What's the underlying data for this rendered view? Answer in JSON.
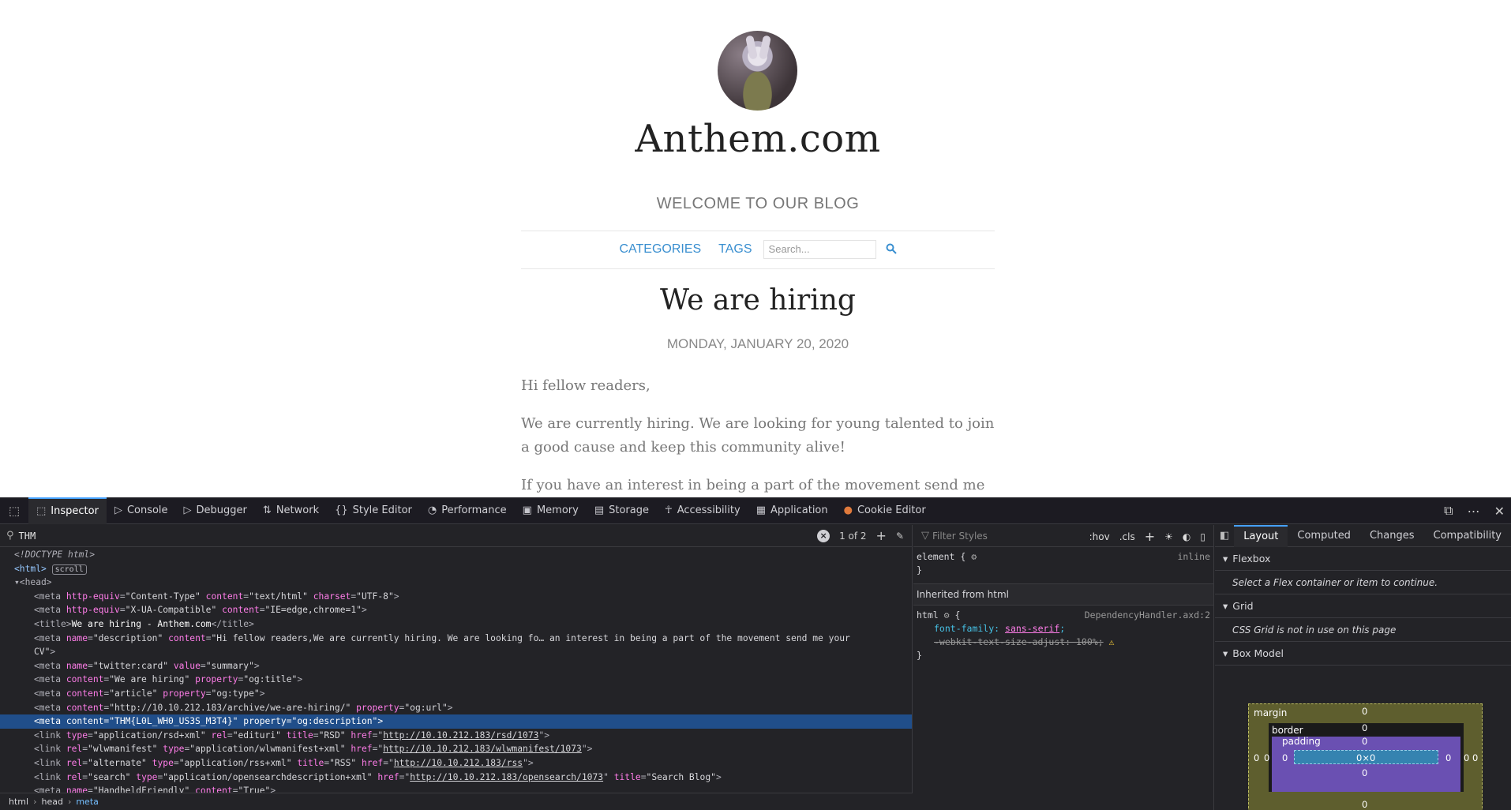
{
  "blog": {
    "site_title": "Anthem.com",
    "tagline": "WELCOME TO OUR BLOG",
    "nav": {
      "categories": "CATEGORIES",
      "tags": "TAGS",
      "search_placeholder": "Search..."
    },
    "post_title": "We are hiring",
    "post_date": "MONDAY, JANUARY 20, 2020",
    "paragraphs": [
      "Hi fellow readers,",
      "We are currently hiring. We are looking for young talented to join a good cause and keep this community alive!",
      "If you have an interest in being a part of the movement send me"
    ]
  },
  "devtools": {
    "tabs": [
      "Inspector",
      "Console",
      "Debugger",
      "Network",
      "Style Editor",
      "Performance",
      "Memory",
      "Storage",
      "Accessibility",
      "Application",
      "Cookie Editor"
    ],
    "search": {
      "value": "THM",
      "count": "1 of 2"
    },
    "tree": {
      "doctype": "<!DOCTYPE html>",
      "html_badge": "scroll",
      "selected_content": "THM{L0L_WH0_US3S_M3T4}"
    },
    "breadcrumbs": [
      "html",
      "head",
      "meta"
    ],
    "rules": {
      "filter_placeholder": "Filter Styles",
      "hov": ":hov",
      "cls": ".cls",
      "element_selector": "element {",
      "inline": "inline",
      "inherited": "Inherited from html",
      "html_selector": "html",
      "source": "DependencyHandler.axd:2",
      "prop1": "font-family",
      "val1": "sans-serif",
      "prop2_struck": "-webkit-text-size-adjust: 100%;"
    },
    "layout": {
      "tabs": [
        "Layout",
        "Computed",
        "Changes",
        "Compatibility"
      ],
      "flexbox": "Flexbox",
      "flexbox_msg": "Select a Flex container or item to continue.",
      "grid": "Grid",
      "grid_msg": "CSS Grid is not in use on this page",
      "box_model": "Box Model",
      "bm_labels": {
        "margin": "margin",
        "border": "border",
        "padding": "padding",
        "content": "0×0"
      }
    }
  }
}
